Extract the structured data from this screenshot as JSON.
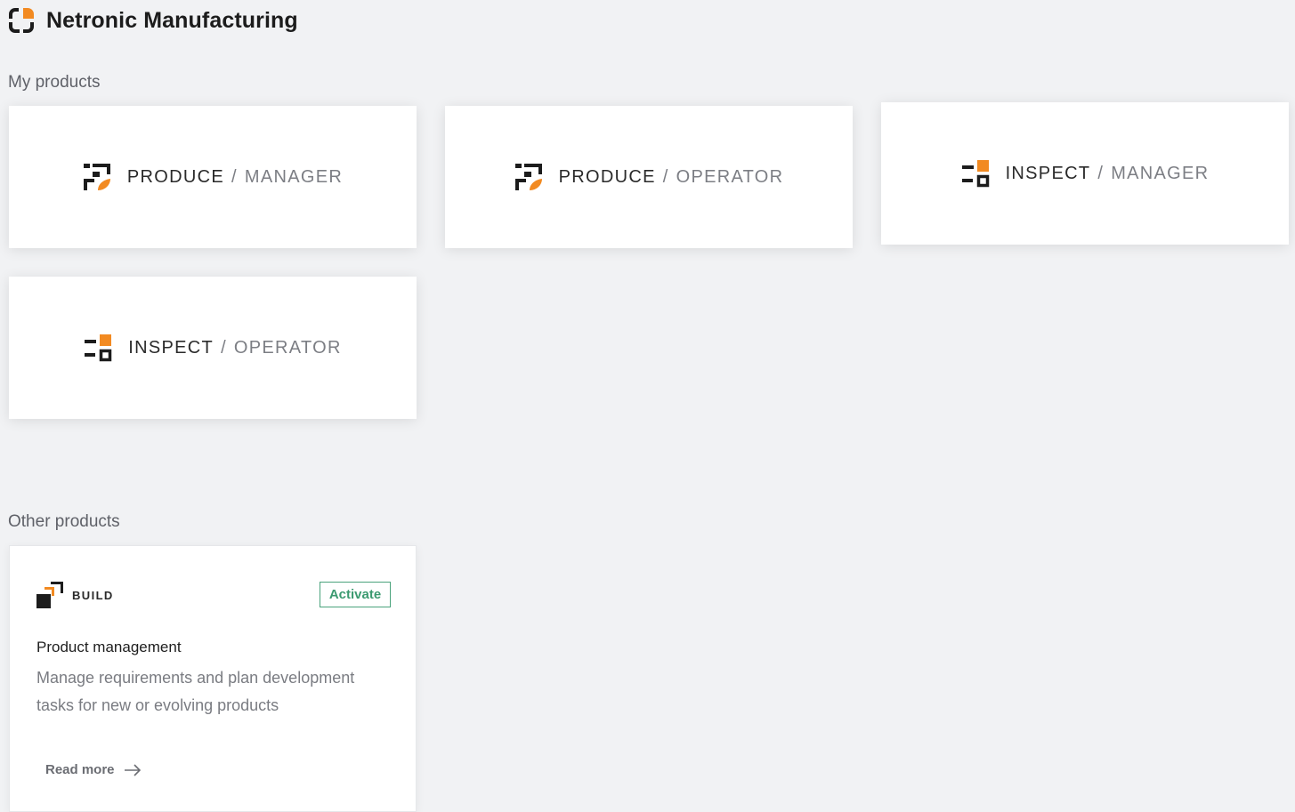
{
  "app": {
    "title": "Netronic Manufacturing",
    "logo_icon": "netronic-logo-icon"
  },
  "my_products": {
    "heading": "My products",
    "items": [
      {
        "product": "PRODUCE",
        "separator": "/",
        "role": "MANAGER",
        "icon": "produce-icon"
      },
      {
        "product": "PRODUCE",
        "separator": "/",
        "role": "OPERATOR",
        "icon": "produce-icon"
      },
      {
        "product": "INSPECT",
        "separator": "/",
        "role": "MANAGER",
        "icon": "inspect-icon"
      },
      {
        "product": "INSPECT",
        "separator": "/",
        "role": "OPERATOR",
        "icon": "inspect-icon"
      }
    ]
  },
  "other_products": {
    "heading": "Other products",
    "items": [
      {
        "product": "BUILD",
        "icon": "build-icon",
        "activate_label": "Activate",
        "title": "Product management",
        "description": "Manage requirements and plan development tasks for new or evolving products",
        "read_more_label": "Read more",
        "read_more_icon": "arrow-right-icon"
      }
    ]
  },
  "colors": {
    "accent": "#f28a21",
    "dark": "#1c1c1c",
    "activate": "#3b9a70",
    "background": "#f1f2f4"
  }
}
